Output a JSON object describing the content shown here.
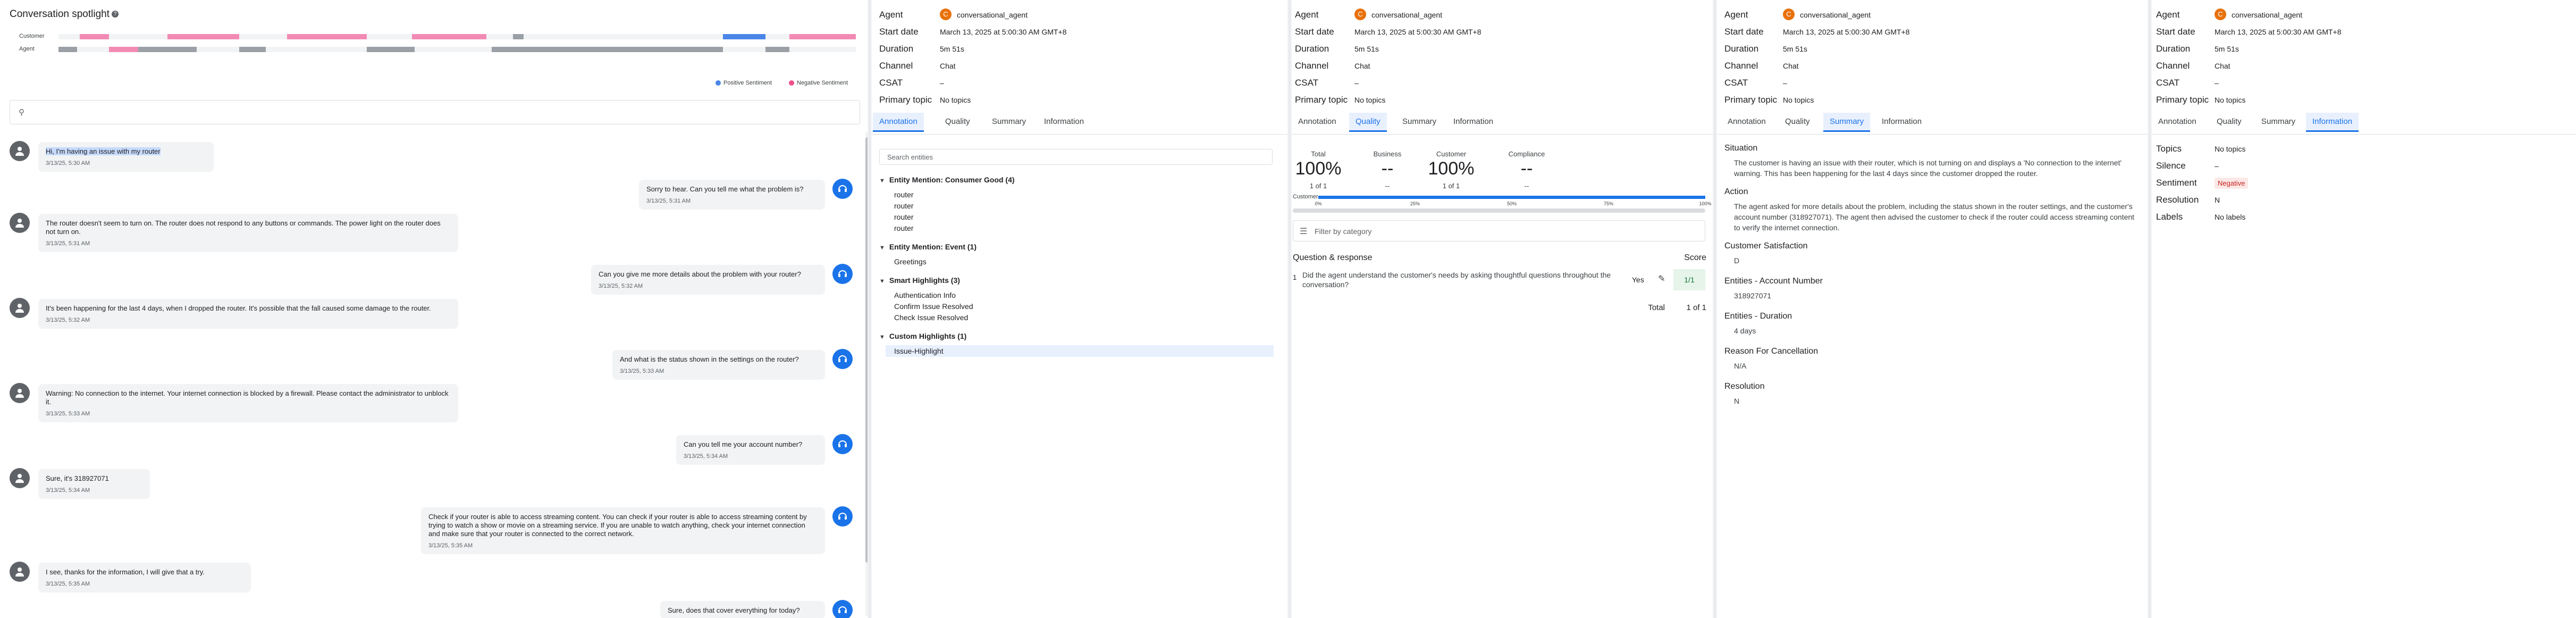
{
  "conversation": {
    "title": "Conversation spotlight",
    "timeline_labels": {
      "customer": "Customer",
      "agent": "Agent"
    },
    "legend": {
      "positive": "Positive Sentiment",
      "negative": "Negative Sentiment"
    },
    "colors": {
      "positive": "#4a86e8",
      "negative": "#f28bb4",
      "agent_bar": "#9aa0a6",
      "customer_bar_neutral": "#dadce0"
    },
    "search_placeholder": "",
    "messages": [
      {
        "role": "customer",
        "text": "Hi, I'm having an issue with my router",
        "time": "3/13/25, 5:30 AM",
        "highlighted": true
      },
      {
        "role": "agent",
        "text": "Sorry to hear. Can you tell me what the problem is?",
        "time": "3/13/25, 5:31 AM"
      },
      {
        "role": "customer",
        "text": "The router doesn't seem to turn on. The router does not respond to any buttons or commands. The power light on the router does not turn on.",
        "time": "3/13/25, 5:31 AM"
      },
      {
        "role": "agent",
        "text": "Can you give me more details about the problem with your router?",
        "time": "3/13/25, 5:32 AM"
      },
      {
        "role": "customer",
        "text": "It's been happening for the last 4 days, when I dropped the router. It's possible that the fall caused some damage to the router.",
        "time": "3/13/25, 5:32 AM"
      },
      {
        "role": "agent",
        "text": "And what is the status shown in the settings on the router?",
        "time": "3/13/25, 5:33 AM"
      },
      {
        "role": "customer",
        "text": "Warning: No connection to the internet. Your internet connection is blocked by a firewall. Please contact the administrator to unblock it.",
        "time": "3/13/25, 5:33 AM"
      },
      {
        "role": "agent",
        "text": "Can you tell me your account number?",
        "time": "3/13/25, 5:34 AM"
      },
      {
        "role": "customer",
        "text": "Sure, it's 318927071",
        "time": "3/13/25, 5:34 AM"
      },
      {
        "role": "agent",
        "text": "Check if your router is able to access streaming content. You can check if your router is able to access streaming content by trying to watch a show or movie on a streaming service. If you are unable to watch anything, check your internet connection and make sure that your router is connected to the correct network.",
        "time": "3/13/25, 5:35 AM"
      },
      {
        "role": "customer",
        "text": "I see, thanks for the information, I will give that a try.",
        "time": "3/13/25, 5:35 AM"
      },
      {
        "role": "agent",
        "text": "Sure, does that cover everything for today?",
        "time": ""
      }
    ]
  },
  "details": {
    "labels": {
      "agent": "Agent",
      "start_date": "Start date",
      "duration": "Duration",
      "channel": "Channel",
      "csat": "CSAT",
      "primary_topic": "Primary topic"
    },
    "values": {
      "agent_initial": "C",
      "agent": "conversational_agent",
      "start_date": "March 13, 2025 at 5:00:30 AM GMT+8",
      "duration": "5m 51s",
      "channel": "Chat",
      "csat": "–",
      "primary_topic": "No topics"
    },
    "tabs": [
      "Annotation",
      "Quality",
      "Summary",
      "Information"
    ]
  },
  "annotation": {
    "search_placeholder": "Search entities",
    "groups": [
      {
        "title": "Entity Mention: Consumer Good (4)",
        "items": [
          "router",
          "router",
          "router",
          "router"
        ]
      },
      {
        "title": "Entity Mention: Event (1)",
        "items": [
          "Greetings"
        ]
      },
      {
        "title": "Smart Highlights (3)",
        "items": [
          "Authentication Info",
          "Confirm Issue Resolved",
          "Check Issue Resolved"
        ]
      },
      {
        "title": "Custom Highlights (1)",
        "items": [
          "Issue-Highlight"
        ]
      }
    ]
  },
  "quality": {
    "scores": [
      {
        "label": "Total",
        "value": "100%",
        "sub": "1 of 1"
      },
      {
        "label": "Business",
        "value": "--",
        "sub": "--"
      },
      {
        "label": "Customer",
        "value": "100%",
        "sub": "1 of 1"
      },
      {
        "label": "Compliance",
        "value": "--",
        "sub": "--"
      }
    ],
    "bar_label": "Customer",
    "bar_fraction": 1.0,
    "bar_ticks": [
      "0%",
      "25%",
      "50%",
      "75%",
      "100%"
    ],
    "filter_placeholder": "Filter by category",
    "header_question": "Question & response",
    "header_score": "Score",
    "questions": [
      {
        "num": "1",
        "text": "Did the agent understand the customer's needs by asking thoughtful questions throughout the conversation?",
        "answer": "Yes",
        "score": "1/1"
      }
    ],
    "total_label": "Total",
    "total_value": "1 of 1"
  },
  "summary": {
    "sections": [
      {
        "label": "Situation",
        "text": "The customer is having an issue with their router, which is not turning on and displays a 'No connection to the internet' warning. This has been happening for the last 4 days since the customer dropped the router."
      },
      {
        "label": "Action",
        "text": "The agent asked for more details about the problem, including the status shown in the router settings, and the customer's account number (318927071). The agent then advised the customer to check if the router could access streaming content to verify the internet connection."
      },
      {
        "label": "Customer Satisfaction",
        "text": "D"
      },
      {
        "label": "Entities - Account Number",
        "text": "318927071"
      },
      {
        "label": "Entities - Duration",
        "text": "4 days"
      },
      {
        "label": "Reason For Cancellation",
        "text": "N/A"
      },
      {
        "label": "Resolution",
        "text": "N"
      }
    ]
  },
  "information": {
    "labels": {
      "topics": "Topics",
      "silence": "Silence",
      "sentiment": "Sentiment",
      "resolution": "Resolution",
      "labels": "Labels"
    },
    "values": {
      "topics": "No topics",
      "silence": "–",
      "sentiment": "Negative",
      "resolution": "N",
      "labels": "No labels"
    }
  }
}
